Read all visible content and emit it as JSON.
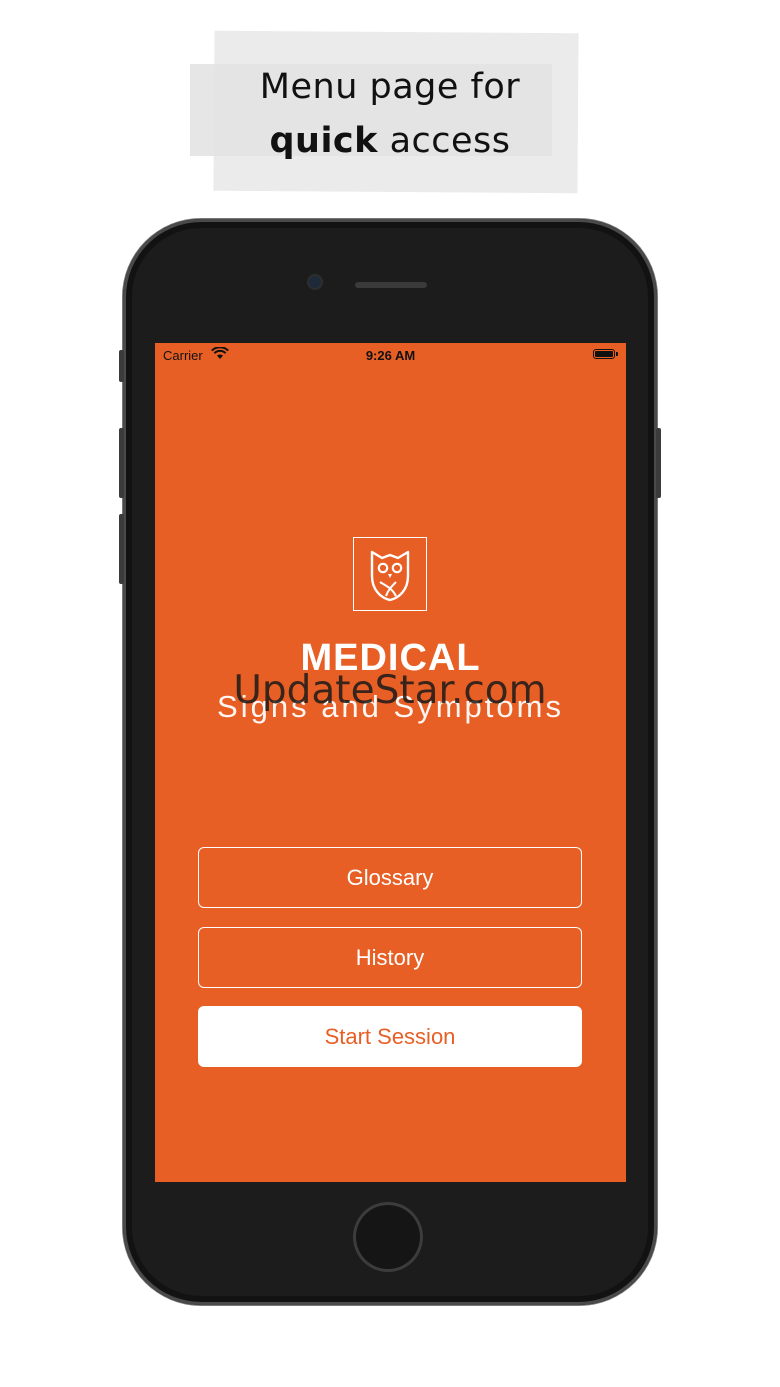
{
  "caption": {
    "line1": "Menu page for",
    "line2_bold": "quick",
    "line2_rest": " access"
  },
  "status_bar": {
    "carrier": "Carrier",
    "time": "9:26 AM"
  },
  "app": {
    "logo_icon": "owl-icon",
    "title": "MEDICAL",
    "subtitle": "Signs and Symptoms"
  },
  "menu": {
    "glossary": "Glossary",
    "history": "History",
    "start_session": "Start Session"
  },
  "watermark": "UpdateStar.com",
  "colors": {
    "accent": "#e85f25",
    "button_fill": "#ffffff"
  }
}
